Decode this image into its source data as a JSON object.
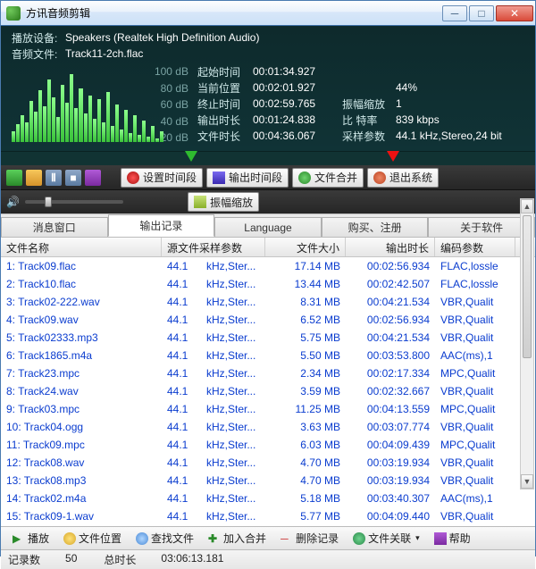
{
  "title": "方讯音频剪辑",
  "playback_device_label": "播放设备:",
  "playback_device_value": "Speakers (Realtek High Definition Audio)",
  "audio_file_label": "音频文件:",
  "audio_file_value": "Track11-2ch.flac",
  "db_scale": [
    "100 dB",
    "80 dB",
    "60 dB",
    "40 dB",
    "20 dB"
  ],
  "meta": {
    "start_time_label": "起始时间",
    "start_time": "00:01:34.927",
    "current_pos_label": "当前位置",
    "current_pos": "00:02:01.927",
    "progress_pct": "44%",
    "end_time_label": "终止时间",
    "end_time": "00:02:59.765",
    "amp_scale_label": "振幅缩放",
    "amp_scale": "1",
    "out_duration_label": "输出时长",
    "out_duration": "00:01:24.838",
    "bitrate_label": "比 特率",
    "bitrate": "839 kbps",
    "file_duration_label": "文件时长",
    "file_duration": "00:04:36.067",
    "sample_label": "采样参数",
    "sample": "44.1  kHz,Stereo,24 bit"
  },
  "toolbar_buttons": {
    "set_time_range": "设置时间段",
    "out_time_range": "输出时间段",
    "file_merge": "文件合并",
    "exit_system": "退出系统",
    "amp_scale_btn": "振幅缩放"
  },
  "tabs": [
    "消息窗口",
    "输出记录",
    "Language",
    "购买、注册",
    "关于软件"
  ],
  "columns": [
    "文件名称",
    "源文件采样参数",
    "",
    "文件大小",
    "输出时长",
    "编码参数"
  ],
  "rows": [
    {
      "n": "1:",
      "name": "Track09.flac",
      "sr": "44.1",
      "fmt": "kHz,Ster...",
      "size": "17.14 MB",
      "dur": "00:02:56.934",
      "enc": "FLAC,lossle"
    },
    {
      "n": "2:",
      "name": "Track10.flac",
      "sr": "44.1",
      "fmt": "kHz,Ster...",
      "size": "13.44 MB",
      "dur": "00:02:42.507",
      "enc": "FLAC,lossle"
    },
    {
      "n": "3:",
      "name": "Track02-222.wav",
      "sr": "44.1",
      "fmt": "kHz,Ster...",
      "size": "8.31 MB",
      "dur": "00:04:21.534",
      "enc": "VBR,Qualit"
    },
    {
      "n": "4:",
      "name": "Track09.wav",
      "sr": "44.1",
      "fmt": "kHz,Ster...",
      "size": "6.52 MB",
      "dur": "00:02:56.934",
      "enc": "VBR,Qualit"
    },
    {
      "n": "5:",
      "name": "Track02333.mp3",
      "sr": "44.1",
      "fmt": "kHz,Ster...",
      "size": "5.75 MB",
      "dur": "00:04:21.534",
      "enc": "VBR,Qualit"
    },
    {
      "n": "6:",
      "name": "Track1865.m4a",
      "sr": "44.1",
      "fmt": "kHz,Ster...",
      "size": "5.50 MB",
      "dur": "00:03:53.800",
      "enc": "AAC(ms),1"
    },
    {
      "n": "7:",
      "name": "Track23.mpc",
      "sr": "44.1",
      "fmt": "kHz,Ster...",
      "size": "2.34 MB",
      "dur": "00:02:17.334",
      "enc": "MPC,Qualit"
    },
    {
      "n": "8:",
      "name": "Track24.wav",
      "sr": "44.1",
      "fmt": "kHz,Ster...",
      "size": "3.59 MB",
      "dur": "00:02:32.667",
      "enc": "VBR,Qualit"
    },
    {
      "n": "9:",
      "name": "Track03.mpc",
      "sr": "44.1",
      "fmt": "kHz,Ster...",
      "size": "11.25 MB",
      "dur": "00:04:13.559",
      "enc": "MPC,Qualit"
    },
    {
      "n": "10:",
      "name": "Track04.ogg",
      "sr": "44.1",
      "fmt": "kHz,Ster...",
      "size": "3.63 MB",
      "dur": "00:03:07.774",
      "enc": "VBR,Qualit"
    },
    {
      "n": "11:",
      "name": "Track09.mpc",
      "sr": "44.1",
      "fmt": "kHz,Ster...",
      "size": "6.03 MB",
      "dur": "00:04:09.439",
      "enc": "MPC,Qualit"
    },
    {
      "n": "12:",
      "name": "Track08.wav",
      "sr": "44.1",
      "fmt": "kHz,Ster...",
      "size": "4.70 MB",
      "dur": "00:03:19.934",
      "enc": "VBR,Qualit"
    },
    {
      "n": "13:",
      "name": "Track08.mp3",
      "sr": "44.1",
      "fmt": "kHz,Ster...",
      "size": "4.70 MB",
      "dur": "00:03:19.934",
      "enc": "VBR,Qualit"
    },
    {
      "n": "14:",
      "name": "Track02.m4a",
      "sr": "44.1",
      "fmt": "kHz,Ster...",
      "size": "5.18 MB",
      "dur": "00:03:40.307",
      "enc": "AAC(ms),1"
    },
    {
      "n": "15:",
      "name": "Track09-1.wav",
      "sr": "44.1",
      "fmt": "kHz,Ster...",
      "size": "5.77 MB",
      "dur": "00:04:09.440",
      "enc": "VBR,Qualit"
    }
  ],
  "bottom_buttons": {
    "play": "播放",
    "file_loc": "文件位置",
    "find_file": "查找文件",
    "add_merge": "加入合并",
    "del_record": "删除记录",
    "file_assoc": "文件关联",
    "help": "帮助"
  },
  "status": {
    "records_label": "记录数",
    "records": "50",
    "total_dur_label": "总时长",
    "total_dur": "03:06:13.181"
  }
}
